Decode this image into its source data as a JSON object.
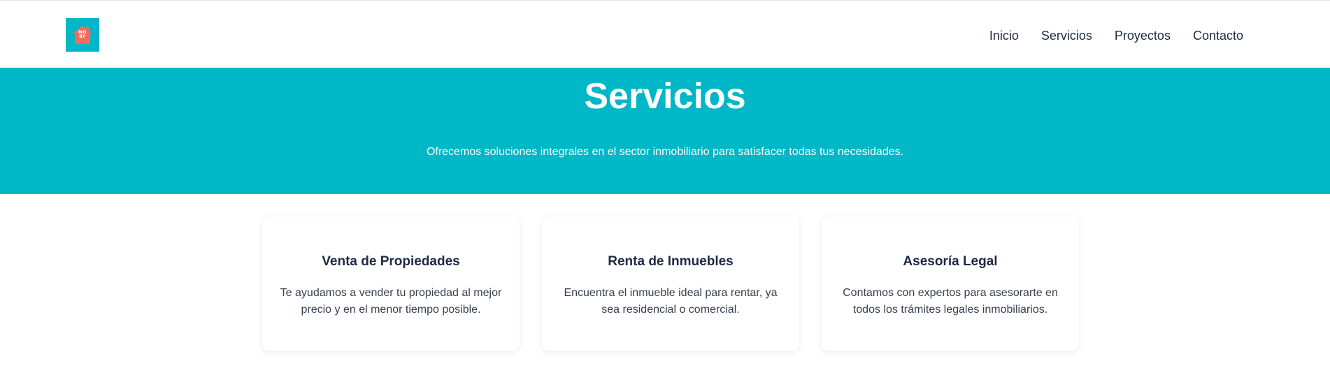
{
  "brand": {
    "logo_text_line1": "MO",
    "logo_text_line2": "BY",
    "logo_bg_color": "#00b7c7",
    "logo_mark_color": "#f26b5b"
  },
  "nav": {
    "items": [
      {
        "label": "Inicio"
      },
      {
        "label": "Servicios"
      },
      {
        "label": "Proyectos"
      },
      {
        "label": "Contacto"
      }
    ]
  },
  "hero": {
    "title": "Servicios",
    "subtitle": "Ofrecemos soluciones integrales en el sector inmobiliario para satisfacer todas tus necesidades.",
    "bg_color": "#00b7c7"
  },
  "services": [
    {
      "title": "Venta de Propiedades",
      "description": "Te ayudamos a vender tu propiedad al mejor precio y en el menor tiempo posible."
    },
    {
      "title": "Renta de Inmuebles",
      "description": "Encuentra el inmueble ideal para rentar, ya sea residencial o comercial."
    },
    {
      "title": "Asesoría Legal",
      "description": "Contamos con expertos para asesorarte en todos los trámites legales inmobiliarios."
    }
  ]
}
